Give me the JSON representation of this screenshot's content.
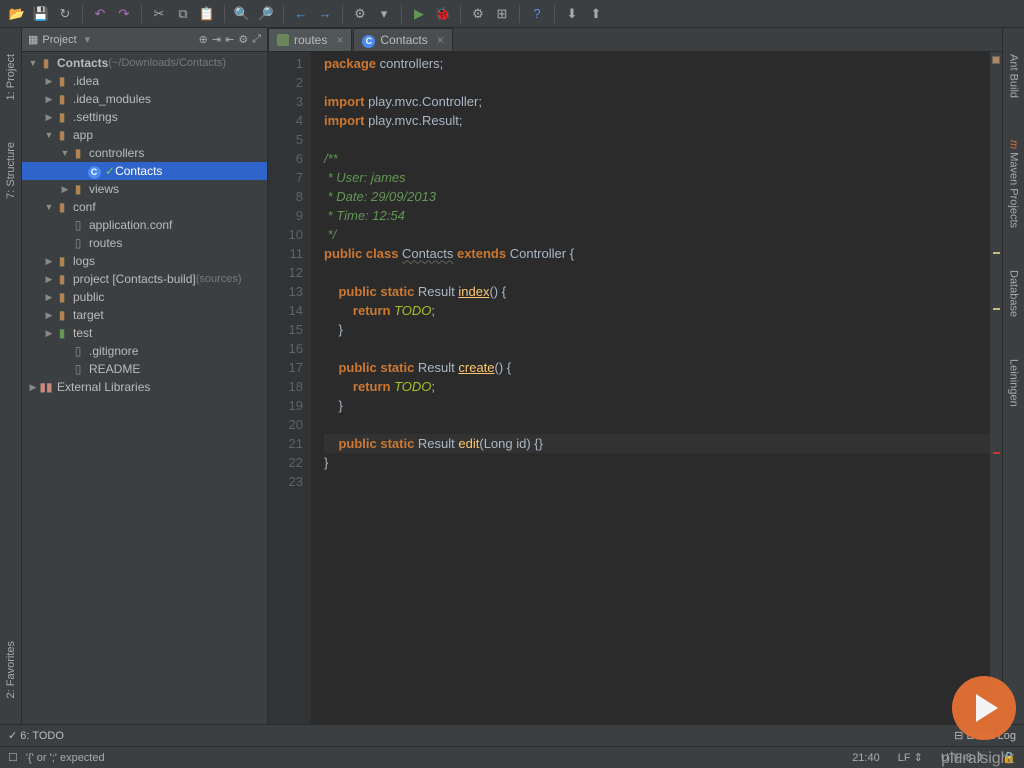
{
  "toolbar": {
    "icons": [
      "open",
      "save",
      "refresh",
      "sep",
      "undo",
      "redo",
      "sep",
      "cut",
      "copy",
      "paste",
      "sep",
      "find",
      "zoom",
      "sep",
      "back",
      "forward",
      "sep",
      "build",
      "menu",
      "sep",
      "run",
      "debug",
      "sep",
      "settings",
      "structure",
      "sep",
      "help",
      "sep",
      "vcs1",
      "vcs2"
    ]
  },
  "left_tabs": [
    "1: Project",
    "7: Structure"
  ],
  "bottom_left_tab": "2: Favorites",
  "right_tabs": [
    "Ant Build",
    "Maven Projects",
    "Database",
    "Leiningen"
  ],
  "project": {
    "header": "Project",
    "root_name": "Contacts",
    "root_path": "(~/Downloads/Contacts)",
    "tree": [
      {
        "indent": 0,
        "arrow": "open",
        "icon": "folder",
        "label": "Contacts",
        "suffix_path": true
      },
      {
        "indent": 1,
        "arrow": "closed",
        "icon": "folder",
        "label": ".idea"
      },
      {
        "indent": 1,
        "arrow": "closed",
        "icon": "folder",
        "label": ".idea_modules"
      },
      {
        "indent": 1,
        "arrow": "closed",
        "icon": "folder",
        "label": ".settings"
      },
      {
        "indent": 1,
        "arrow": "open",
        "icon": "folder",
        "label": "app"
      },
      {
        "indent": 2,
        "arrow": "open",
        "icon": "folder",
        "label": "controllers"
      },
      {
        "indent": 3,
        "arrow": "none",
        "icon": "class",
        "label": "Contacts",
        "selected": true,
        "check": true
      },
      {
        "indent": 2,
        "arrow": "closed",
        "icon": "folder",
        "label": "views"
      },
      {
        "indent": 1,
        "arrow": "open",
        "icon": "folder",
        "label": "conf"
      },
      {
        "indent": 2,
        "arrow": "none",
        "icon": "file",
        "label": "application.conf"
      },
      {
        "indent": 2,
        "arrow": "none",
        "icon": "file",
        "label": "routes"
      },
      {
        "indent": 1,
        "arrow": "closed",
        "icon": "folder",
        "label": "logs"
      },
      {
        "indent": 1,
        "arrow": "closed",
        "icon": "folder",
        "label": "project [Contacts-build]",
        "suffix": "(sources)"
      },
      {
        "indent": 1,
        "arrow": "closed",
        "icon": "folder",
        "label": "public"
      },
      {
        "indent": 1,
        "arrow": "closed",
        "icon": "folder",
        "label": "target"
      },
      {
        "indent": 1,
        "arrow": "closed",
        "icon": "testfolder",
        "label": "test"
      },
      {
        "indent": 2,
        "arrow": "none",
        "icon": "file",
        "label": ".gitignore"
      },
      {
        "indent": 2,
        "arrow": "none",
        "icon": "file",
        "label": "README"
      },
      {
        "indent": 0,
        "arrow": "closed",
        "icon": "lib",
        "label": "External Libraries"
      }
    ]
  },
  "tabs": [
    {
      "icon": "routes",
      "label": "routes",
      "active": false
    },
    {
      "icon": "class",
      "label": "Contacts",
      "active": true
    }
  ],
  "code": {
    "lines": [
      {
        "n": 1,
        "tokens": [
          [
            "kw",
            "package "
          ],
          [
            "ident",
            "controllers"
          ],
          [
            "punc",
            ";"
          ]
        ]
      },
      {
        "n": 2,
        "tokens": []
      },
      {
        "n": 3,
        "tokens": [
          [
            "kw",
            "import "
          ],
          [
            "ident",
            "play.mvc.Controller"
          ],
          [
            "punc",
            ";"
          ]
        ]
      },
      {
        "n": 4,
        "tokens": [
          [
            "kw",
            "import "
          ],
          [
            "ident",
            "play.mvc.Result"
          ],
          [
            "punc",
            ";"
          ]
        ]
      },
      {
        "n": 5,
        "tokens": []
      },
      {
        "n": 6,
        "tokens": [
          [
            "cmt",
            "/**"
          ]
        ]
      },
      {
        "n": 7,
        "tokens": [
          [
            "cmt",
            " * User: james"
          ]
        ]
      },
      {
        "n": 8,
        "tokens": [
          [
            "cmt",
            " * Date: 29/09/2013"
          ]
        ]
      },
      {
        "n": 9,
        "tokens": [
          [
            "cmt",
            " * Time: 12:54"
          ]
        ]
      },
      {
        "n": 10,
        "tokens": [
          [
            "cmt",
            " */"
          ]
        ]
      },
      {
        "n": 11,
        "tokens": [
          [
            "kw",
            "public class "
          ],
          [
            "cls",
            "Contacts"
          ],
          [
            "kw",
            " extends "
          ],
          [
            "typ",
            "Controller "
          ],
          [
            "punc",
            "{"
          ]
        ]
      },
      {
        "n": 12,
        "tokens": []
      },
      {
        "n": 13,
        "tokens": [
          [
            "punc",
            "    "
          ],
          [
            "kw",
            "public static "
          ],
          [
            "typ",
            "Result "
          ],
          [
            "fnu",
            "index"
          ],
          [
            "punc",
            "() {"
          ]
        ]
      },
      {
        "n": 14,
        "tokens": [
          [
            "punc",
            "        "
          ],
          [
            "kw",
            "return "
          ],
          [
            "todo",
            "TODO"
          ],
          [
            "punc",
            ";"
          ]
        ]
      },
      {
        "n": 15,
        "tokens": [
          [
            "punc",
            "    }"
          ]
        ]
      },
      {
        "n": 16,
        "tokens": []
      },
      {
        "n": 17,
        "tokens": [
          [
            "punc",
            "    "
          ],
          [
            "kw",
            "public static "
          ],
          [
            "typ",
            "Result "
          ],
          [
            "fnu",
            "create"
          ],
          [
            "punc",
            "() {"
          ]
        ]
      },
      {
        "n": 18,
        "tokens": [
          [
            "punc",
            "        "
          ],
          [
            "kw",
            "return "
          ],
          [
            "todo",
            "TODO"
          ],
          [
            "punc",
            ";"
          ]
        ]
      },
      {
        "n": 19,
        "tokens": [
          [
            "punc",
            "    }"
          ]
        ]
      },
      {
        "n": 20,
        "tokens": []
      },
      {
        "n": 21,
        "tokens": [
          [
            "punc",
            "    "
          ],
          [
            "kw",
            "public static "
          ],
          [
            "typ",
            "Result "
          ],
          [
            "fn",
            "edit"
          ],
          [
            "punc",
            "(Long id) {}"
          ]
        ],
        "current": true
      },
      {
        "n": 22,
        "tokens": [
          [
            "punc",
            "}"
          ]
        ]
      },
      {
        "n": 23,
        "tokens": []
      }
    ]
  },
  "bottom": {
    "todo_tab": "6: TODO",
    "event_log": "Event Log"
  },
  "status": {
    "message": "'{' or ';' expected",
    "pos": "21:40",
    "line_sep": "LF",
    "encoding": "UTF-8"
  },
  "branding": "pluralsight"
}
